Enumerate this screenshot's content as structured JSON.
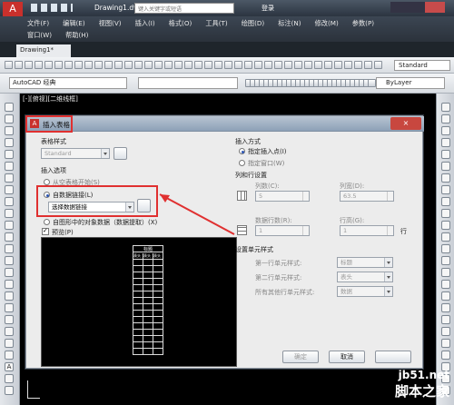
{
  "app": {
    "title": "Drawing1.dwg",
    "search_placeholder": "键入关键字或短语",
    "login": "登录"
  },
  "menus": {
    "row1": [
      "文件(F)",
      "编辑(E)",
      "视图(V)",
      "插入(I)",
      "格式(O)",
      "工具(T)",
      "绘图(D)",
      "标注(N)",
      "修改(M)",
      "参数(P)"
    ],
    "row2": [
      "窗口(W)",
      "帮助(H)"
    ]
  },
  "tab": "Drawing1*",
  "toolbar": {
    "style_value": "Standard",
    "workspace": "AutoCAD 经典",
    "bylayer": "ByLayer"
  },
  "viewport_label": "[-][俯视][二维线框]",
  "dialog": {
    "title": "插入表格",
    "table_style_label": "表格样式",
    "table_style_value": "Standard",
    "insert_options_label": "插入选项",
    "from_empty": "从空表格开始(S)",
    "from_data_link": "自数据链接(L)",
    "data_link_value": "选择数据链接",
    "from_objects": "自图形中的对象数据（数据提取）(X)",
    "preview_label": "预览(P)",
    "preview_header": "标题",
    "preview_row_label": "表头",
    "insert_method_label": "插入方式",
    "insert_point": "指定插入点(I)",
    "insert_window": "指定窗口(W)",
    "rows_cols_label": "列和行设置",
    "columns_label": "列数(C):",
    "columns_value": "5",
    "col_width_label": "列宽(D):",
    "col_width_value": "63.5",
    "data_rows_label": "数据行数(R):",
    "data_rows_value": "1",
    "row_height_label": "行高(G):",
    "row_height_value": "1",
    "row_unit": "行",
    "cell_style_label": "设置单元样式",
    "first_row_label": "第一行单元样式:",
    "first_row_value": "标题",
    "second_row_label": "第二行单元样式:",
    "second_row_value": "表头",
    "other_rows_label": "所有其他行单元样式:",
    "other_rows_value": "数据",
    "ok": "确定",
    "cancel": "取消"
  },
  "watermark": {
    "site": "jb51.net",
    "name": "脚本之家"
  },
  "colors": {
    "annotation": "#e03030",
    "canvas": "#000000"
  }
}
